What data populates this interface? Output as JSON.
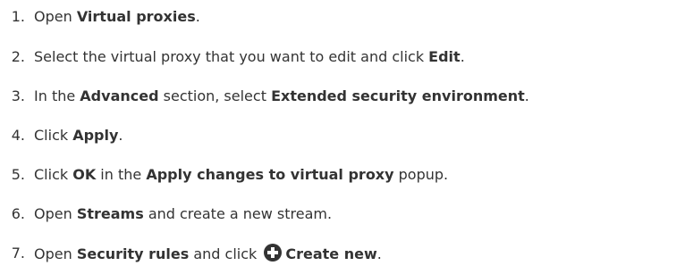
{
  "steps": [
    {
      "num": "1.",
      "parts": [
        "Open ",
        "Virtual proxies",
        "."
      ]
    },
    {
      "num": "2.",
      "parts": [
        "Select the virtual proxy that you want to edit and click ",
        "Edit",
        "."
      ]
    },
    {
      "num": "3.",
      "parts": [
        "In the ",
        "Advanced",
        " section, select ",
        "Extended security environment",
        "."
      ]
    },
    {
      "num": "4.",
      "parts": [
        "Click ",
        "Apply",
        "."
      ]
    },
    {
      "num": "5.",
      "parts": [
        "Click ",
        "OK",
        " in the ",
        "Apply changes to virtual proxy",
        " popup."
      ]
    },
    {
      "num": "6.",
      "parts": [
        "Open ",
        "Streams",
        " and create a new stream."
      ]
    },
    {
      "num": "7.",
      "parts": [
        "Open ",
        "Security rules",
        " and click ",
        "Create new",
        "."
      ]
    }
  ],
  "icons": {
    "create_new": "plus-circle-icon"
  },
  "colors": {
    "text": "#333333",
    "background": "#ffffff"
  }
}
